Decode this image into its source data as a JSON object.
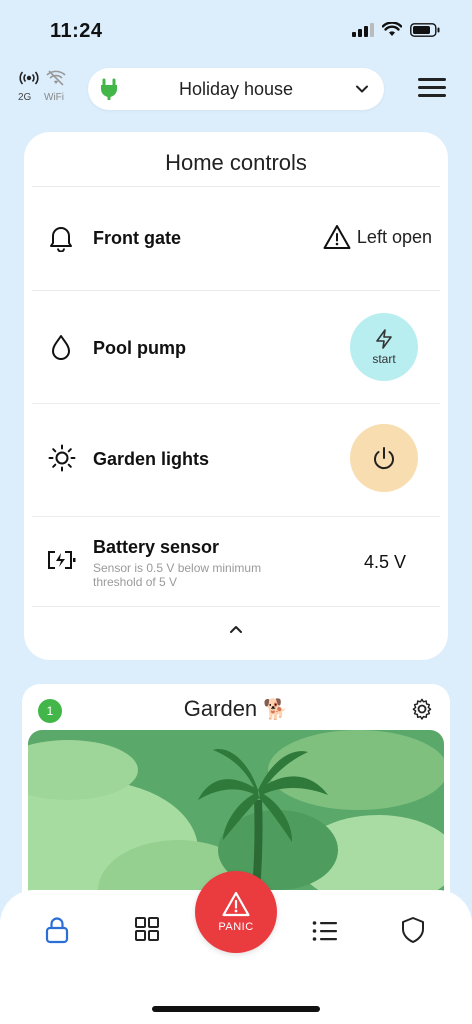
{
  "status_bar": {
    "time": "11:24"
  },
  "connection": {
    "cellular_label": "2G",
    "wifi_label": "WiFi"
  },
  "site_selector": {
    "selected": "Holiday house"
  },
  "home_controls": {
    "title": "Home controls",
    "items": [
      {
        "label": "Front gate",
        "status": "Left open",
        "icon": "bell-icon"
      },
      {
        "label": "Pool pump",
        "action_label": "start",
        "icon": "drop-icon"
      },
      {
        "label": "Garden lights",
        "icon": "sun-icon"
      },
      {
        "label": "Battery sensor",
        "subtext": "Sensor is 0.5 V below minimum threshold of 5 V",
        "value": "4.5 V",
        "icon": "battery-charging-icon"
      }
    ]
  },
  "garden": {
    "badge": "1",
    "title": "Garden",
    "emoji": "🐕"
  },
  "bottom_nav": {
    "items": [
      "lock-icon",
      "grid-icon",
      "list-icon",
      "shield-icon"
    ],
    "panic_label": "PANIC"
  },
  "colors": {
    "background": "#dceefc",
    "start_button": "#b9eef1",
    "power_button": "#f8ddb0",
    "panic": "#ea3b3f",
    "badge": "#43b649",
    "active_nav": "#2a6fd6"
  }
}
